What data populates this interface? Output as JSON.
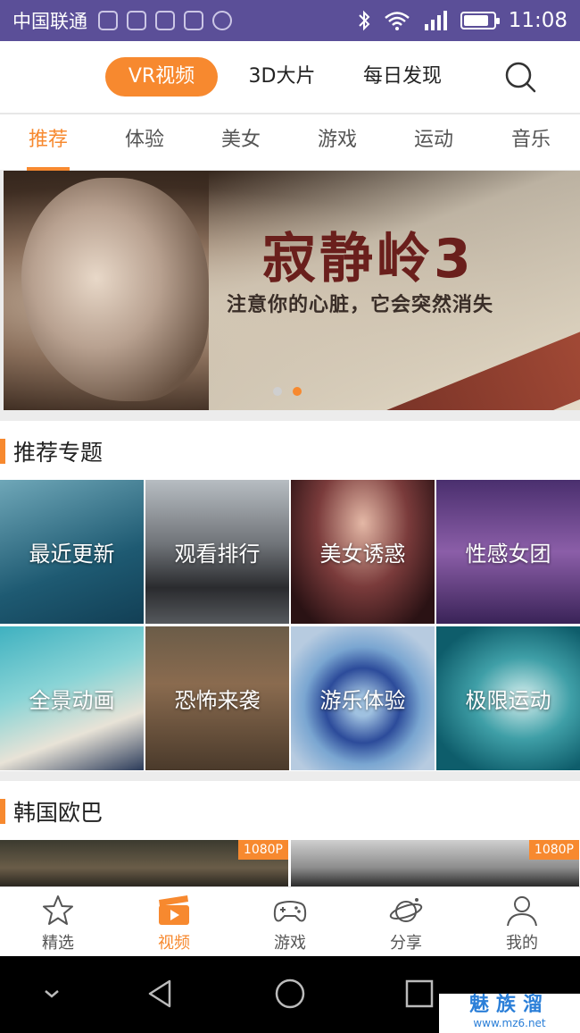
{
  "status_bar": {
    "carrier": "中国联通",
    "time": "11:08",
    "battery_level": 0.85
  },
  "top_nav": {
    "tabs": [
      "VR视频",
      "3D大片",
      "每日发现"
    ],
    "active_tab": "VR视频"
  },
  "category_tabs": {
    "items": [
      "推荐",
      "体验",
      "美女",
      "游戏",
      "运动",
      "音乐"
    ],
    "active": "推荐"
  },
  "banner": {
    "title": "寂静岭3",
    "subtitle": "注意你的心脏，它会突然消失",
    "slide_count": 2,
    "active_slide": 2
  },
  "recommended": {
    "heading": "推荐专题",
    "tiles": [
      "最近更新",
      "观看排行",
      "美女诱惑",
      "性感女团",
      "全景动画",
      "恐怖来袭",
      "游乐体验",
      "极限运动"
    ]
  },
  "korea": {
    "heading": "韩国欧巴",
    "badges": [
      "1080P",
      "1080P"
    ]
  },
  "bottom_tabs": {
    "items": [
      "精选",
      "视频",
      "游戏",
      "分享",
      "我的"
    ],
    "active": "视频"
  },
  "watermark": {
    "main": "魅族溜",
    "sub": "www.mz6.net"
  },
  "colors": {
    "accent": "#f7892f",
    "status_bar": "#5b4f98"
  }
}
